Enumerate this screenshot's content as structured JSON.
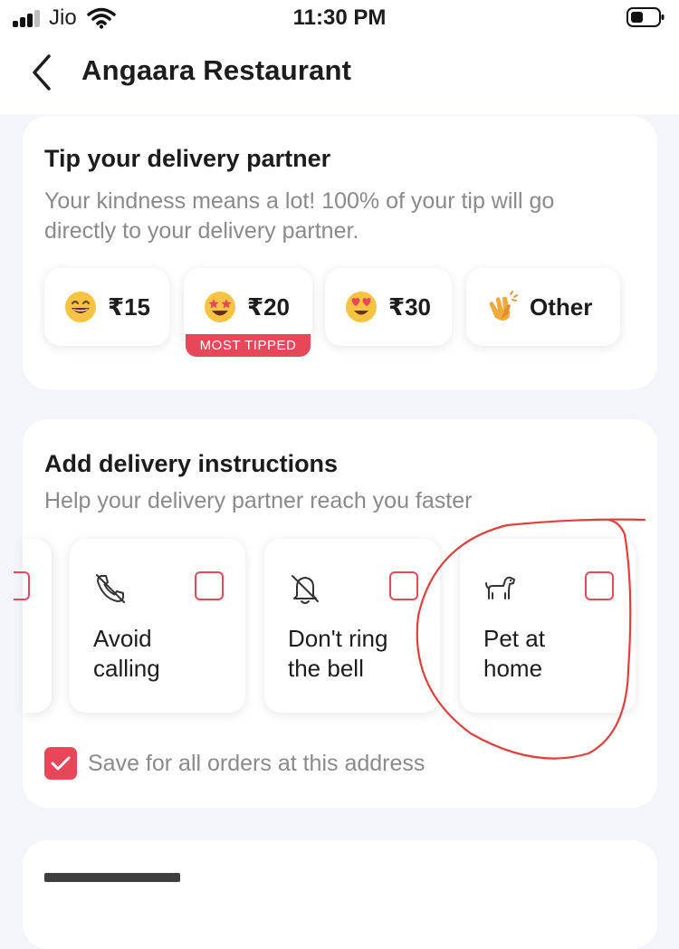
{
  "status_bar": {
    "carrier": "Jio",
    "time": "11:30 PM"
  },
  "header": {
    "title": "Angaara Restaurant"
  },
  "tip": {
    "title": "Tip your delivery partner",
    "subtitle_line1": "Your kindness means a lot! 100% of your tip will go",
    "subtitle_line2": "directly to your delivery partner.",
    "options": [
      {
        "label": "₹15",
        "icon": "grinning-face-icon"
      },
      {
        "label": "₹20",
        "icon": "star-struck-face-icon",
        "badge": "MOST TIPPED"
      },
      {
        "label": "₹30",
        "icon": "heart-eyes-face-icon"
      },
      {
        "label": "Other",
        "icon": "clapping-hands-icon"
      }
    ]
  },
  "instructions": {
    "title": "Add delivery instructions",
    "subtitle": "Help your delivery partner reach you faster",
    "options": [
      {
        "line1": "Avoid",
        "line2": "calling",
        "icon": "phone-off-icon",
        "checked": false
      },
      {
        "line1": "Don't ring",
        "line2": "the bell",
        "icon": "bell-off-icon",
        "checked": false
      },
      {
        "line1": "Pet at",
        "line2": "home",
        "icon": "dog-icon",
        "checked": false
      }
    ],
    "save_label": "Save for all orders at this address",
    "save_checked": true
  },
  "colors": {
    "accent": "#e8475a",
    "annotation": "#e0403c"
  }
}
